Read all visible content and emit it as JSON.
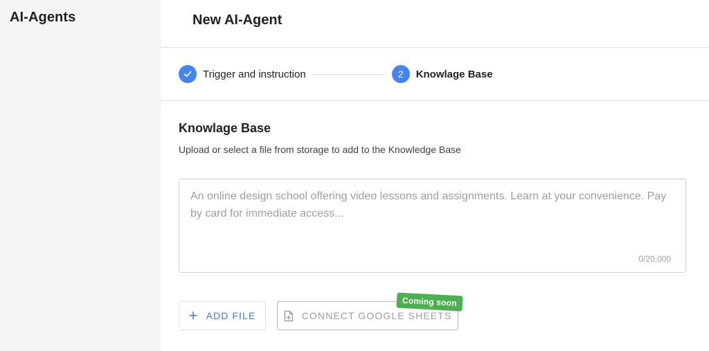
{
  "sidebar": {
    "title": "AI-Agents"
  },
  "header": {
    "title": "New AI-Agent"
  },
  "stepper": {
    "steps": [
      {
        "number": "",
        "label": "Trigger and instruction",
        "status": "completed",
        "icon": "check-icon"
      },
      {
        "number": "2",
        "label": "Knowlage Base",
        "status": "active"
      }
    ]
  },
  "knowledge_base": {
    "title": "Knowlage Base",
    "subtitle": "Upload or select a file from storage to add to the Knowledge Base",
    "textarea": {
      "value": "",
      "placeholder": "An online design school offering video lessons and assignments. Learn at your convenience. Pay by card for immediate access...",
      "char_count": "0/20,000"
    },
    "add_file_label": "ADD FILE",
    "connect_sheets_label": "CONNECT GOOGLE SHEETS",
    "connect_sheets_icon": "document-plus-icon",
    "badge": "Coming soon"
  },
  "colors": {
    "accent": "#4285f4",
    "badge": "#4caf50",
    "sidebar_bg": "#f5f5f5"
  }
}
